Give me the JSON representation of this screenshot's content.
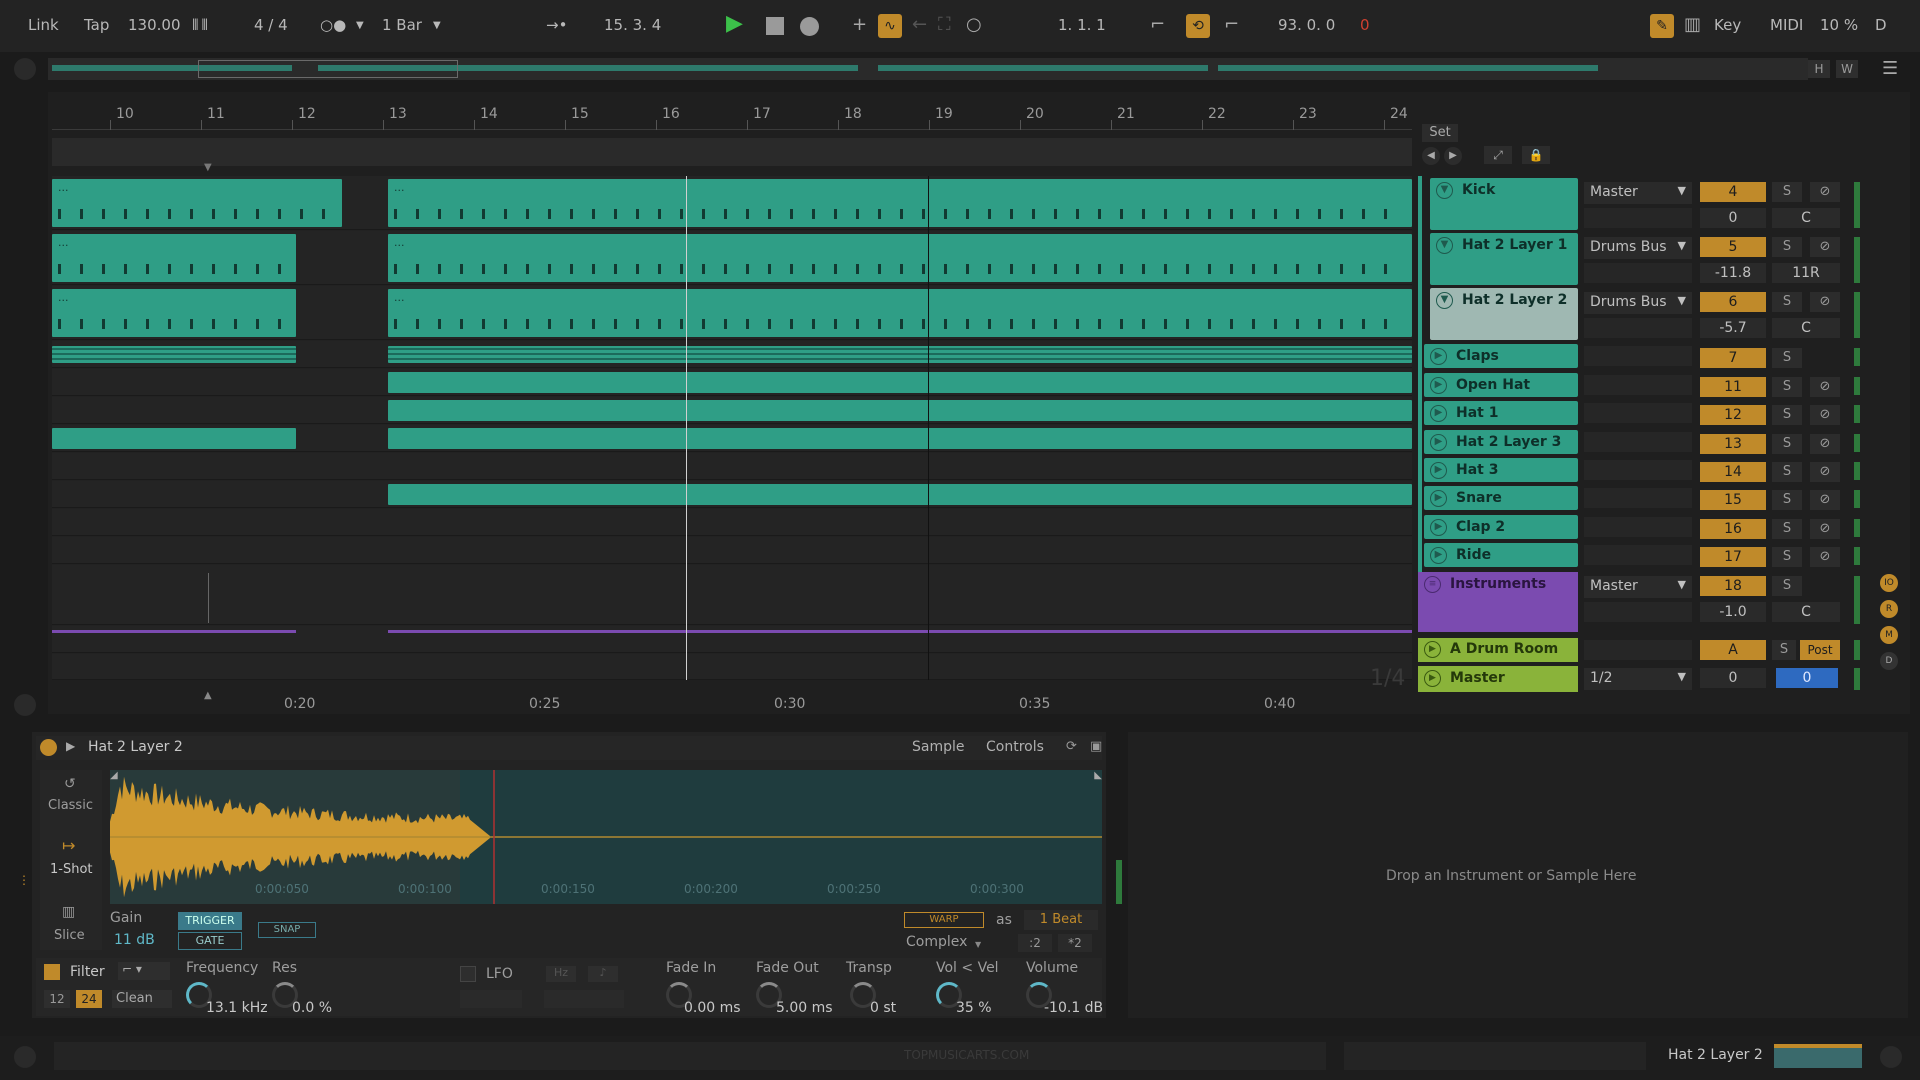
{
  "topbar": {
    "link": "Link",
    "tap": "Tap",
    "tempo": "130.00",
    "time_sig": "4 / 4",
    "quantize": "1 Bar",
    "position": "15.  3.  4",
    "loop_start": "1.  1.  1",
    "loop_length": "93.  0.  0",
    "key": "Key",
    "midi": "MIDI",
    "cpu": "10 %",
    "d": "D"
  },
  "overview": {
    "h": "H",
    "w": "W"
  },
  "ruler": {
    "bars": [
      "10",
      "11",
      "12",
      "13",
      "14",
      "15",
      "16",
      "17",
      "18",
      "19",
      "20",
      "21",
      "22",
      "23",
      "24"
    ]
  },
  "timeline": {
    "times": [
      "0:20",
      "0:25",
      "0:30",
      "0:35",
      "0:40"
    ],
    "page": "1/4"
  },
  "set_button": "Set",
  "tracks": [
    {
      "name": "Kick",
      "route": "Master",
      "num": "4",
      "vol": "0",
      "pan": "C",
      "solo": "S",
      "expanded": true
    },
    {
      "name": "Hat 2 Layer 1",
      "route": "Drums Bus",
      "num": "5",
      "vol": "-11.8",
      "pan": "11R",
      "solo": "S",
      "expanded": true
    },
    {
      "name": "Hat 2 Layer 2",
      "route": "Drums Bus",
      "num": "6",
      "vol": "-5.7",
      "pan": "C",
      "solo": "S",
      "expanded": true
    },
    {
      "name": "Claps",
      "num": "7",
      "solo": "S"
    },
    {
      "name": "Open Hat",
      "num": "11",
      "solo": "S"
    },
    {
      "name": "Hat 1",
      "num": "12",
      "solo": "S"
    },
    {
      "name": "Hat 2 Layer 3",
      "num": "13",
      "solo": "S"
    },
    {
      "name": "Hat 3",
      "num": "14",
      "solo": "S"
    },
    {
      "name": "Snare",
      "num": "15",
      "solo": "S"
    },
    {
      "name": "Clap 2",
      "num": "16",
      "solo": "S"
    },
    {
      "name": "Ride",
      "num": "17",
      "solo": "S"
    }
  ],
  "instruments": {
    "name": "Instruments",
    "route": "Master",
    "num": "18",
    "vol": "-1.0",
    "pan": "C",
    "solo": "S"
  },
  "return": {
    "name": "A Drum Room",
    "num": "A",
    "solo": "S",
    "post": "Post"
  },
  "master": {
    "name": "Master",
    "route": "1/2",
    "num": "0",
    "vol": "0"
  },
  "device": {
    "title": "Hat 2 Layer 2",
    "tab_sample": "Sample",
    "tab_controls": "Controls",
    "mode_classic": "Classic",
    "mode_oneshot": "1-Shot",
    "mode_slice": "Slice",
    "gain_label": "Gain",
    "gain_value": "11 dB",
    "trigger": "TRIGGER",
    "gate": "GATE",
    "snap": "SNAP",
    "warp": "WARP",
    "as": "as",
    "beat": "1 Beat",
    "complex": "Complex",
    "div2": ":2",
    "mul2": "*2",
    "wave_times": [
      "0:00:050",
      "0:00:100",
      "0:00:150",
      "0:00:200",
      "0:00:250",
      "0:00:300"
    ],
    "filter": "Filter",
    "f12": "12",
    "f24": "24",
    "clean": "Clean",
    "freq_label": "Frequency",
    "freq_value": "13.1 kHz",
    "res_label": "Res",
    "res_value": "0.0 %",
    "lfo": "LFO",
    "hz": "Hz",
    "fadein_label": "Fade In",
    "fadein_value": "0.00 ms",
    "fadeout_label": "Fade Out",
    "fadeout_value": "5.00 ms",
    "transp_label": "Transp",
    "transp_value": "0 st",
    "volvel_label": "Vol < Vel",
    "volvel_value": "35 %",
    "volume_label": "Volume",
    "volume_value": "-10.1 dB"
  },
  "dropzone": "Drop an Instrument or Sample Here",
  "status": {
    "watermark": "TOPMUSICARTS.COM",
    "selected": "Hat 2 Layer 2"
  },
  "colors": {
    "clip": "#2f9e86",
    "accent": "#c08a2a",
    "instrument": "#7b4bb0",
    "return": "#8ab33a",
    "play": "#3cc04a"
  }
}
